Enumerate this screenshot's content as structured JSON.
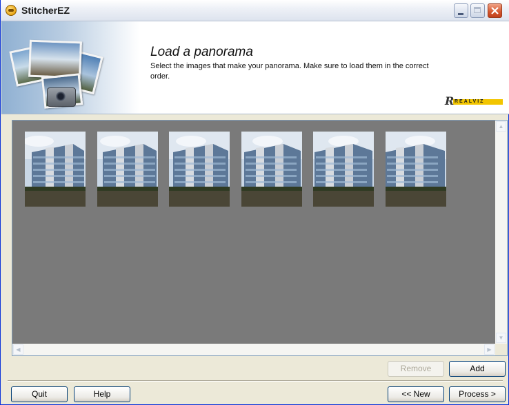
{
  "window": {
    "title": "StitcherEZ",
    "controls": [
      "minimize-icon",
      "maximize-icon",
      "close-icon"
    ]
  },
  "header": {
    "title": "Load a panorama",
    "description": "Select the images that make your panorama. Make sure to load them in the correct order.",
    "logo": "REALVIZ"
  },
  "images": [
    {
      "index": 1,
      "icon": "building-photo"
    },
    {
      "index": 2,
      "icon": "building-photo"
    },
    {
      "index": 3,
      "icon": "building-photo"
    },
    {
      "index": 4,
      "icon": "building-photo"
    },
    {
      "index": 5,
      "icon": "building-photo"
    },
    {
      "index": 6,
      "icon": "building-photo"
    }
  ],
  "actions": {
    "remove": "Remove",
    "add": "Add"
  },
  "footer": {
    "quit": "Quit",
    "help": "Help",
    "new": "<< New",
    "process": "Process >"
  },
  "colors": {
    "canvas_bg": "#7a7a7a",
    "title_bar": "#eef1f7",
    "close_button": "#d4552c",
    "logo_yellow": "#f2c500"
  }
}
